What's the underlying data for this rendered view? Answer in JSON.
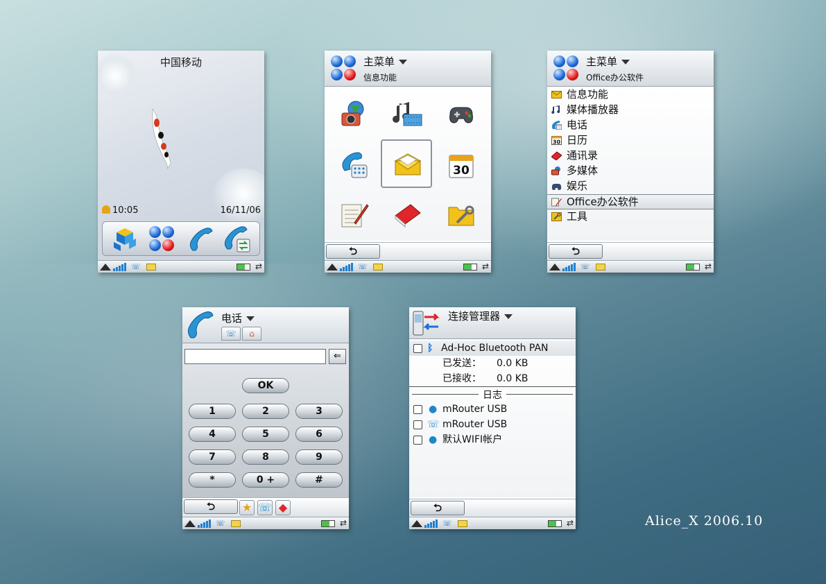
{
  "home": {
    "carrier": "中国移动",
    "time": "10:05",
    "date": "16/11/06",
    "dock": [
      {
        "icon": "blocks-icon"
      },
      {
        "icon": "main-menu-dots-icon"
      },
      {
        "icon": "phone-handset-icon"
      },
      {
        "icon": "call-transfer-icon"
      }
    ]
  },
  "main_menu_grid": {
    "title": "主菜单",
    "subtitle": "信息功能",
    "icons": [
      "globe-camera-icon",
      "music-film-icon",
      "gamepad-icon",
      "phone-keypad-icon",
      "message-envelope-icon",
      "calendar-30-icon",
      "notes-icon",
      "contacts-book-icon",
      "tools-folder-icon"
    ],
    "calendar_number": "30",
    "back_label": "⮌"
  },
  "main_menu_list": {
    "title": "主菜单",
    "subtitle": "Office办公软件",
    "items": [
      {
        "label": "信息功能",
        "icon": "envelope-icon",
        "color": "#f2c21a"
      },
      {
        "label": "媒体播放器",
        "icon": "music-note-icon",
        "color": "#4b6fb0"
      },
      {
        "label": "电话",
        "icon": "phone-icon",
        "color": "#1f86c8"
      },
      {
        "label": "日历",
        "icon": "calendar-icon",
        "color": "#e8a21c"
      },
      {
        "label": "通讯录",
        "icon": "contacts-icon",
        "color": "#e0262a"
      },
      {
        "label": "多媒体",
        "icon": "multimedia-icon",
        "color": "#2f8a3c"
      },
      {
        "label": "娱乐",
        "icon": "gamepad-icon",
        "color": "#3a4a6a"
      },
      {
        "label": "Office办公软件",
        "icon": "office-icon",
        "color": "#c23b3b",
        "selected": true
      },
      {
        "label": "工具",
        "icon": "tools-icon",
        "color": "#e3b51d"
      }
    ],
    "calendar_number": "30",
    "back_label": "⮌"
  },
  "dialer": {
    "title": "电话",
    "ok_label": "OK",
    "keys": [
      "1",
      "2",
      "3",
      "4",
      "5",
      "6",
      "7",
      "8",
      "9",
      "*",
      "0 +",
      "#"
    ],
    "delete_label": "⇐",
    "back_label": "⮌"
  },
  "connection_manager": {
    "title": "连接管理器",
    "bluetooth": {
      "name": "Ad-Hoc Bluetooth PAN",
      "sent_label": "已发送：",
      "sent_value": "0.0 KB",
      "received_label": "已接收：",
      "received_value": "0.0 KB"
    },
    "log_label": "日志",
    "entries": [
      {
        "label": "mRouter USB",
        "icon": "globe-small-icon"
      },
      {
        "label": "mRouter USB",
        "icon": "phone-small-icon"
      },
      {
        "label": "默认WIFI帐户",
        "icon": "globe-small-icon"
      }
    ],
    "back_label": "⮌"
  },
  "credit": "Alice_X  2006.10"
}
